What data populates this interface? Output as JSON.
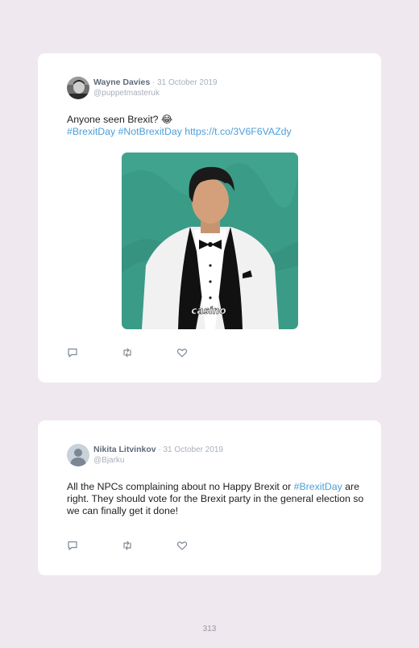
{
  "tweets": [
    {
      "author": "Wayne Davies",
      "separator": " · ",
      "date": "31 October 2019",
      "handle": "@puppetmasteruk",
      "text": "Anyone seen Brexit? 😂",
      "hashtags": [
        "#BrexitDay",
        "#NotBrexitDay"
      ],
      "link": "https://t.co/3V6F6VAZdy",
      "media": {
        "caption": "casino",
        "background_color": "#3a9b86",
        "jacket_color": "#f1f1f1"
      },
      "icons": [
        "reply-icon",
        "retweet-icon",
        "like-icon"
      ]
    },
    {
      "author": "Nikita Litvinkov",
      "separator": " · ",
      "date": "31 October 2019",
      "handle": "@Bjarku",
      "text_before": "All the NPCs complaining about no Happy Brexit or ",
      "hashtag": "#BrexitDay",
      "text_after": " are right. They should vote for the Brexit party in the general election so we can finally get it done!",
      "icons": [
        "reply-icon",
        "retweet-icon",
        "like-icon"
      ]
    }
  ],
  "page_number": "313",
  "colors": {
    "background": "#efe8ef",
    "card": "#ffffff",
    "link": "#4b9fd9",
    "author": "#5f6a7a",
    "muted": "#a8b0bb"
  }
}
